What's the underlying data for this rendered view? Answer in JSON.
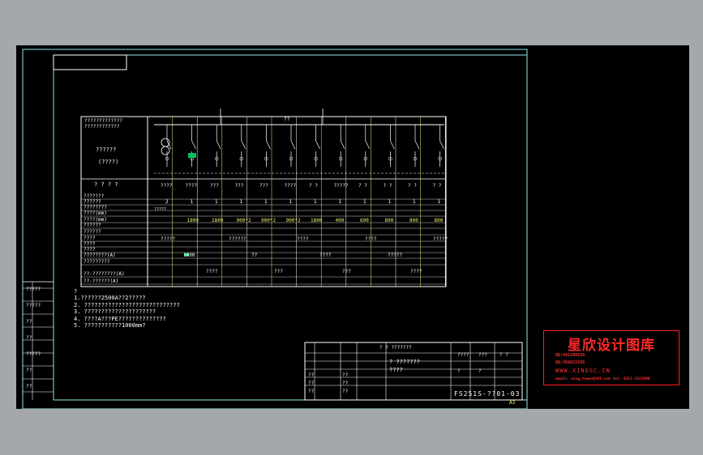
{
  "panel_header": {
    "line1": "?????????????",
    "line2": "????????????",
    "name1": "??????",
    "name2": "(????)",
    "marks": "? ? ? ?"
  },
  "bus_label": "??",
  "busbar_label": "?????",
  "row_labels": [
    "???????",
    "??????",
    "????????",
    "????(mm)",
    "????(mm)",
    "??????",
    "??????",
    "????",
    "????",
    "????",
    "????????(A)",
    "?????????",
    "??-????????(A)",
    "??-??????(A)"
  ],
  "top_codes": [
    "????",
    "????",
    "???",
    "???",
    "???",
    "????",
    "? ?",
    "?????",
    "? ?",
    "? ?",
    "? ?",
    "? ?"
  ],
  "numbers_row": [
    "2",
    "1",
    "1",
    "1",
    "1",
    "1",
    "1",
    "1",
    "1",
    "1",
    "1",
    "1"
  ],
  "dims_row": [
    "1800",
    "1800",
    "900*2",
    "900*2",
    "900*2",
    "1800",
    "400",
    "600",
    "800",
    "800",
    "800"
  ],
  "misc_cells": [
    "?????",
    "1800",
    "????",
    "??????",
    "??",
    "???",
    "????",
    "????",
    "???",
    "????",
    "?????",
    "????",
    "?????"
  ],
  "notes": [
    "?",
    "1.??????2500A??2?????",
    "2.  ????????????????????????????",
    "3.  ?????????????????????",
    "4.  ????A???PE??????????????",
    "5.  ???????????1000mm?"
  ],
  "title_block": {
    "title": "? ? ???????",
    "sub1": "?  ???????",
    "sub2": "????",
    "drawing_no": "FS251S-??01-03",
    "sheet": "A3",
    "roles": [
      "??",
      "??",
      "??",
      "??",
      "??",
      "??"
    ],
    "fields": [
      "????",
      "???",
      "? ?",
      "?",
      "?"
    ]
  },
  "left_block": [
    "?????",
    "?????",
    "??",
    "??",
    "?????",
    "??",
    "??"
  ],
  "stamp": {
    "title": "星欣设计图库",
    "qq1": "QQ:441200336",
    "qq2": "QQ:356621936",
    "web": "WWW.XINGSC.CN",
    "email": "email: xing_tuwen@163.com  tel: 0311-1523800"
  },
  "colors": {
    "background": "#000000",
    "border": "#ffffff",
    "accent": "#f2ee6a",
    "cyan": "#00ffff",
    "stamp": "#ff2020"
  }
}
